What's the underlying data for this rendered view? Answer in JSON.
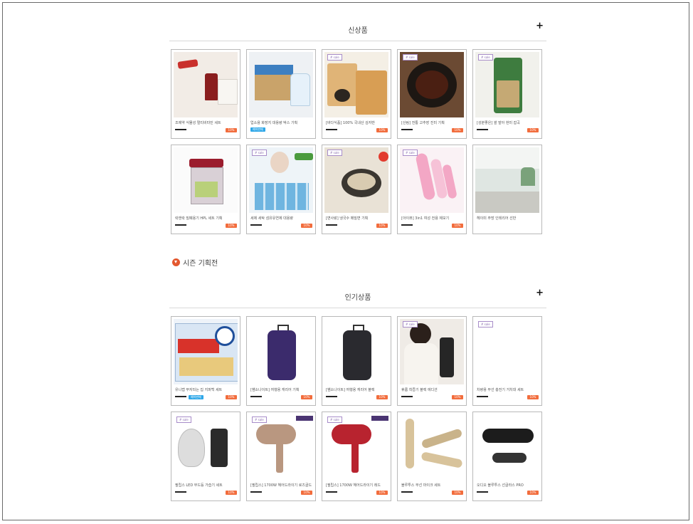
{
  "sections": {
    "new": {
      "title": "신상품",
      "plus": "+",
      "items": [
        {
          "name": "조제약 식물성 멀티비타민 세트",
          "sale": "10%",
          "tag": "",
          "badge": ""
        },
        {
          "name": "업소용 화장지 대용량 박스 기획",
          "sale": "",
          "tag": "",
          "badge": "예약판매"
        },
        {
          "name": "[바다식품] 100% 국내산 김자반",
          "sale": "10%",
          "tag": "# sale",
          "badge": ""
        },
        {
          "name": "[산림] 전통 고추장 진미 기획",
          "sale": "10%",
          "tag": "# sale",
          "badge": ""
        },
        {
          "name": "[성분좋은] 쌀 발아 현미 잡곡",
          "sale": "10%",
          "tag": "# sale",
          "badge": ""
        },
        {
          "name": "락앤락 밀폐용기 HPL 세트 기획",
          "sale": "10%",
          "tag": "",
          "badge": ""
        },
        {
          "name": "세제 세탁 섬유유연제 대용량",
          "sale": "10%",
          "tag": "# sale",
          "badge": ""
        },
        {
          "name": "[면사랑] 냉국수 메밀면 기획",
          "sale": "10%",
          "tag": "# sale",
          "badge": ""
        },
        {
          "name": "[아이뷰] 3in1 여성 전용 제모기",
          "sale": "10%",
          "tag": "# sale",
          "badge": ""
        },
        {
          "name": "헤이미 주방 인테리어 선반",
          "sale": "",
          "tag": "",
          "badge": ""
        }
      ]
    },
    "popular": {
      "title": "인기상품",
      "plus": "+",
      "items": [
        {
          "name": "유니랩 부자되는 집 지퍼백 세트",
          "sale": "10%",
          "tag": "",
          "badge": "예약판매"
        },
        {
          "name": "[쌤소나이트] 여행용 캐리어 기획",
          "sale": "10%",
          "tag": "",
          "badge": ""
        },
        {
          "name": "[쌤소나이트] 여행용 캐리어 블랙",
          "sale": "10%",
          "tag": "",
          "badge": ""
        },
        {
          "name": "휴롬 착즙기 블랙 에디션",
          "sale": "10%",
          "tag": "# sale",
          "badge": ""
        },
        {
          "name": "차량용 무선 충전기 거치대 세트",
          "sale": "10%",
          "tag": "# sale",
          "badge": ""
        },
        {
          "name": "필립스 LED 무드등 가습기 세트",
          "sale": "10%",
          "tag": "# sale",
          "badge": ""
        },
        {
          "name": "[필립스] 1700W 헤어드라이기 로즈골드",
          "sale": "10%",
          "tag": "# sale",
          "badge": ""
        },
        {
          "name": "[필립스] 1700W 헤어드라이기 레드",
          "sale": "10%",
          "tag": "# sale",
          "badge": ""
        },
        {
          "name": "블루투스 무선 마이크 세트",
          "sale": "10%",
          "tag": "",
          "badge": ""
        },
        {
          "name": "오디오 블루투스 선글라스 PRO",
          "sale": "10%",
          "tag": "",
          "badge": ""
        }
      ]
    }
  },
  "season": {
    "label": "시즌 기획전",
    "icon": "season-badge-icon"
  },
  "colors": {
    "sale": "#f26d3d",
    "badge": "#2ea7e8",
    "tag": "#8a6db0"
  }
}
